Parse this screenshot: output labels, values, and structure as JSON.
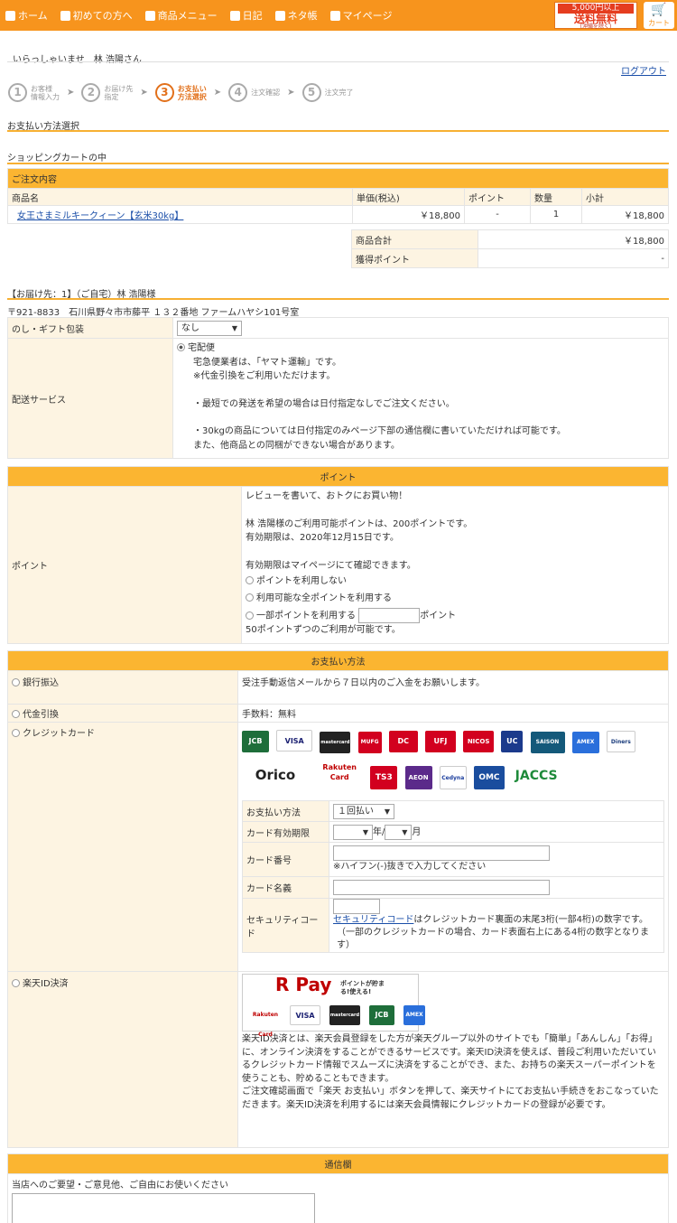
{
  "nav": {
    "items": [
      {
        "label": "ホーム",
        "icon": "home-icon"
      },
      {
        "label": "初めての方へ",
        "icon": "shield-icon"
      },
      {
        "label": "商品メニュー",
        "icon": "bag-icon"
      },
      {
        "label": "日記",
        "icon": "book-icon"
      },
      {
        "label": "ネタ帳",
        "icon": "note-icon"
      },
      {
        "label": "マイページ",
        "icon": "user-icon"
      }
    ],
    "badge_line1": "5,000円以上",
    "badge_line2": "送料無料",
    "badge_line3": "(沖縄を除く)",
    "cart_label": "カート",
    "colors": {
      "accent": "#f7941d",
      "header": "#fbb531"
    }
  },
  "greeting": "いらっしゃいませ　林 浩陽さん",
  "logout": "ログアウト",
  "steps": [
    {
      "num": "1",
      "line1": "お客様",
      "line2": "情報入力"
    },
    {
      "num": "2",
      "line1": "お届け先",
      "line2": "指定"
    },
    {
      "num": "3",
      "line1": "お支払い",
      "line2": "方法選択"
    },
    {
      "num": "4",
      "line1": "注文確認",
      "line2": ""
    },
    {
      "num": "5",
      "line1": "注文完了",
      "line2": ""
    }
  ],
  "page_title": "お支払い方法選択",
  "cart_title": "ショッピングカートの中",
  "order": {
    "header": "ご注文内容",
    "columns": [
      "商品名",
      "単価(税込)",
      "ポイント",
      "数量",
      "小計"
    ],
    "item_name": "女王さまミルキークィーン【玄米30kg】",
    "price": "￥18,800",
    "point": "-",
    "qty": "1",
    "subtotal": "￥18,800",
    "total_label": "商品合計",
    "total_value": "￥18,800",
    "points_label": "獲得ポイント",
    "points_value": "-"
  },
  "delivery": {
    "title": "【お届け先：1】（ご自宅）林 浩陽様",
    "address": "〒921-8833　石川県野々市市藤平 １３２番地 ファームハヤシ101号室",
    "gift_label": "のし・ギフト包装",
    "gift_value": "なし",
    "service_label": "配送サービス",
    "service_option": "宅配便",
    "service_lines": [
      "宅急便業者は、「ヤマト運輸」です。",
      "※代金引換をご利用いただけます。",
      "",
      "・最短での発送を希望の場合は日付指定なしでご注文ください。",
      "",
      "・30kgの商品については日付指定のみページ下部の通信欄に書いていただければ可能です。",
      "また、他商品との同梱ができない場合があります。"
    ]
  },
  "points": {
    "header": "ポイント",
    "label": "ポイント",
    "line1": "レビューを書いて、おトクにお買い物！",
    "line2": "林 浩陽様のご利用可能ポイントは、200ポイントです。",
    "line3": "有効期限は、2020年12月15日です。",
    "line4": "有効期限はマイページにて確認できます。",
    "opt1": "ポイントを利用しない",
    "opt2": "利用可能な全ポイントを利用する",
    "opt3": "一部ポイントを利用する",
    "opt3_unit": "ポイント",
    "note": "50ポイントずつのご利用が可能です。"
  },
  "payment": {
    "header": "お支払い方法",
    "bank_label": "銀行振込",
    "bank_desc": "受注手動返信メールから７日以内のご入金をお願いします。",
    "cod_label": "代金引換",
    "cod_desc": "手数料：無料",
    "card_label": "クレジットカード",
    "card_logos_row1": [
      "JCB",
      "VISA",
      "mastercard",
      "MUFG",
      "DC",
      "UFJ",
      "NICOS",
      "UC",
      "SAISON",
      "AMEX",
      "Diners"
    ],
    "card_logos_row2": [
      "Orico",
      "Rakuten Card",
      "TS3",
      "AEON",
      "Cedyna",
      "OMC",
      "JACCS"
    ],
    "form": {
      "method_label": "お支払い方法",
      "method_value": "１回払い",
      "expiry_label": "カード有効期限",
      "year_unit": "年/",
      "month_unit": "月",
      "number_label": "カード番号",
      "number_note": "※ハイフン(-)抜きで入力してください",
      "name_label": "カード名義",
      "security_label": "セキュリティコード",
      "security_link": "セキュリティコード",
      "security_desc": "はクレジットカード裏面の末尾3桁(一部4桁)の数字です。",
      "security_note": "（一部のクレジットカードの場合、カード表面右上にある4桁の数字となります）"
    },
    "rakuten_label": "楽天ID決済",
    "rpay_logo": "R Pay",
    "rpay_tag": "ポイントが貯まる!使える!",
    "rakuten_desc1": "楽天ID決済とは、楽天会員登録をした方が楽天グループ以外のサイトでも「簡単」「あんしん」「お得」に、オンライン決済をすることができるサービスです。楽天ID決済を使えば、普段ご利用いただいているクレジットカード情報でスムーズに決済をすることができ、また、お持ちの楽天スーパーポイントを使うことも、貯めることもできます。",
    "rakuten_desc2": "ご注文確認画面で「楽天 お支払い」ボタンを押して、楽天サイトにてお支払い手続きをおこなっていただきます。楽天ID決済を利用するには楽天会員情報にクレジットカードの登録が必要です。"
  },
  "comm": {
    "header": "通信欄",
    "label": "当店へのご要望・ご意見他、ご自由にお使いください"
  }
}
